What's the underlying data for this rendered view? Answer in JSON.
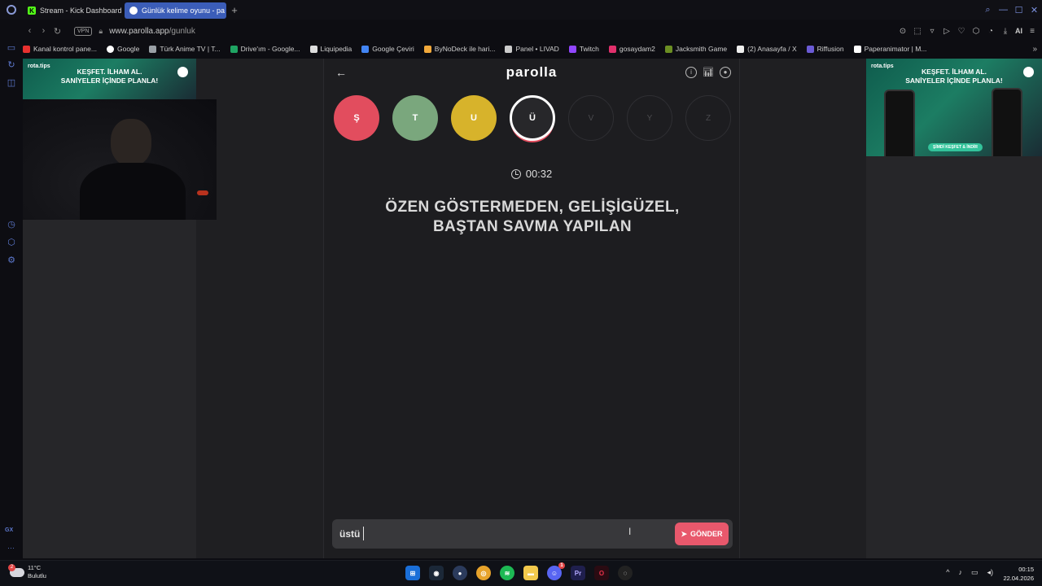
{
  "browser": {
    "tabs": [
      {
        "label": "Stream - Kick Dashboard",
        "active": false
      },
      {
        "label": "Günlük kelime oyunu - pa",
        "active": true
      }
    ],
    "address": {
      "url_domain": "www.parolla.app",
      "url_path": "/gunluk",
      "vpn_label": "VPN"
    },
    "ai_label": "AI",
    "bookmarks": [
      {
        "label": "Kanal kontrol pane...",
        "color": "#e8312f"
      },
      {
        "label": "Google",
        "color": "#ffffff"
      },
      {
        "label": "Türk Anime TV | T...",
        "color": "#9aa0a6"
      },
      {
        "label": "Drive'ım - Google...",
        "color": "#1fa463"
      },
      {
        "label": "Liquipedia",
        "color": "#dddddd"
      },
      {
        "label": "Google Çeviri",
        "color": "#4285f4"
      },
      {
        "label": "ByNoDeck ile hari...",
        "color": "#f2a93b"
      },
      {
        "label": "Panel • LIVAD",
        "color": "#cccccc"
      },
      {
        "label": "Twitch",
        "color": "#9146ff"
      },
      {
        "label": "gosaydam2",
        "color": "#e1306c"
      },
      {
        "label": "Jacksmith Game",
        "color": "#6b8e23"
      },
      {
        "label": "(2) Anasayfa / X",
        "color": "#eeeeee"
      },
      {
        "label": "Riffusion",
        "color": "#6b5bd6"
      },
      {
        "label": "Paperanimator | M...",
        "color": "#ffffff"
      }
    ]
  },
  "ads": {
    "brand": "rota.tips",
    "headline_1": "KEŞFET. İLHAM AL.",
    "headline_2": "SANİYELER İÇİNDE PLANLA!",
    "cta": "ŞİMDİ KEŞFET & İNDİR"
  },
  "game": {
    "logo": "parolla",
    "letters": [
      {
        "char": "Ş",
        "state": "wrong"
      },
      {
        "char": "T",
        "state": "correct"
      },
      {
        "char": "U",
        "state": "passed"
      },
      {
        "char": "Ü",
        "state": "active"
      },
      {
        "char": "V",
        "state": "pending"
      },
      {
        "char": "Y",
        "state": "pending"
      },
      {
        "char": "Z",
        "state": "pending"
      }
    ],
    "timer": "00:32",
    "question_line1": "ÖZEN GÖSTERMEDEN, GELİŞİGÜZEL,",
    "question_line2": "BAŞTAN SAVMA YAPILAN",
    "answer_value": "üstü",
    "submit_label": "GÖNDER"
  },
  "colors": {
    "wrong": "#e24d5e",
    "correct": "#7aa77d",
    "passed": "#d7b32b",
    "accent": "#e8586c"
  },
  "taskbar": {
    "weather_temp": "11°C",
    "weather_desc": "Bulutlu",
    "weather_badge": "2",
    "time": "00:15",
    "date": "22.04.2026",
    "discord_badge": "1"
  }
}
